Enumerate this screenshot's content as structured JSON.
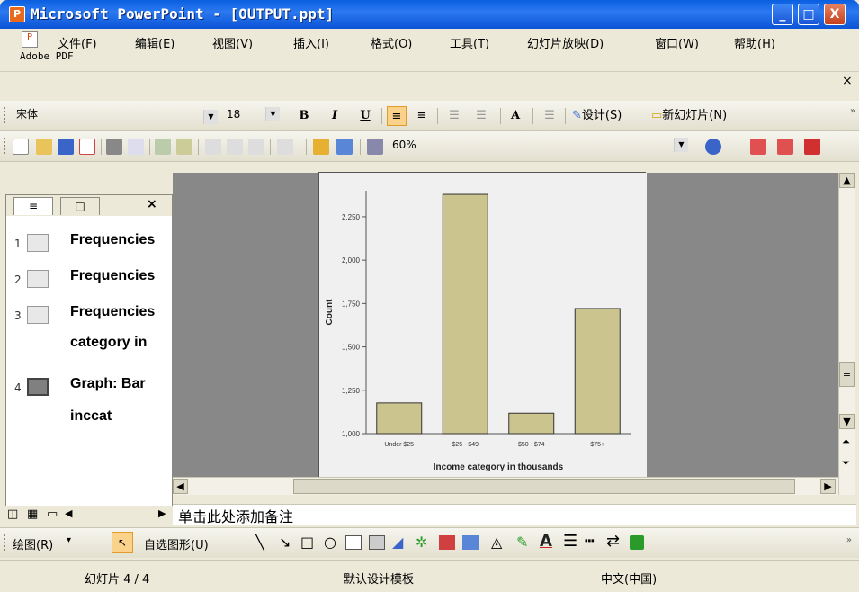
{
  "window": {
    "title": "Microsoft PowerPoint - [OUTPUT.ppt]",
    "minimize": "_",
    "maximize": "□",
    "close": "X"
  },
  "menu": {
    "items": [
      "文件(F)",
      "编辑(E)",
      "视图(V)",
      "插入(I)",
      "格式(O)",
      "工具(T)",
      "幻灯片放映(D)",
      "窗口(W)",
      "帮助(H)"
    ],
    "adobe": "Adobe PDF",
    "close": "×"
  },
  "format_toolbar": {
    "font": "宋体",
    "size": "18",
    "bold": "B",
    "italic": "I",
    "underline": "U",
    "grow_font": "A",
    "design": "设计(S)",
    "new_slide": "新幻灯片(N)"
  },
  "standard_toolbar": {
    "zoom": "60%"
  },
  "outline": {
    "tab_outline": "≡",
    "tab_slides": "□",
    "tab_close": "×",
    "items": [
      {
        "num": "1",
        "text": "Frequencies"
      },
      {
        "num": "2",
        "text": "Frequencies"
      },
      {
        "num": "3",
        "text": "Frequencies",
        "text2": "category in"
      },
      {
        "num": "4",
        "text": "Graph: Bar",
        "text2": "inccat"
      }
    ]
  },
  "notes_placeholder": "单击此处添加备注",
  "drawing_toolbar": {
    "draw": "绘图(R)",
    "autoshapes": "自选图形(U)"
  },
  "status": {
    "slide": "幻灯片 4 / 4",
    "template": "默认设计模板",
    "language": "中文(中国)"
  },
  "chart_data": {
    "type": "bar",
    "categories": [
      "Under $25",
      "$25 - $49",
      "$50 - $74",
      "$75+"
    ],
    "values": [
      1177,
      2379,
      1118,
      1721
    ],
    "xlabel": "Income category in thousands",
    "ylabel": "Count",
    "ylim": [
      1000,
      2400
    ],
    "yticks": [
      "1,000",
      "1,250",
      "1,500",
      "1,750",
      "2,000",
      "2,250"
    ],
    "bar_color": "#cbc48e",
    "grid": false
  }
}
